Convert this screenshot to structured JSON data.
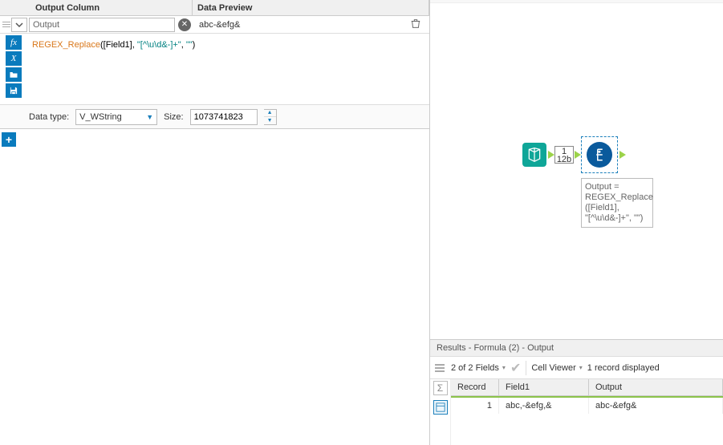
{
  "headers": {
    "output_col": "Output Column",
    "data_preview": "Data Preview"
  },
  "field": {
    "name": "Output",
    "preview": "abc-&efg&",
    "formula_fn": "REGEX_Replace",
    "formula_args_plain": "([Field1], ",
    "formula_pat": "\"[^\\u\\d&-]+\"",
    "formula_mid": ", ",
    "formula_rep": "\"\"",
    "formula_close": ")",
    "datatype_label": "Data type:",
    "datatype_value": "V_WString",
    "size_label": "Size:",
    "size_value": "1073741823"
  },
  "canvas": {
    "badge_top": "1",
    "badge_bottom": "12b",
    "tooltip_l1": "Output =",
    "tooltip_l2": "REGEX_Replace",
    "tooltip_l3": "([Field1],",
    "tooltip_l4": "\"[^\\u\\d&-]+\", \"\")"
  },
  "results": {
    "title": "Results - Formula (2) - Output",
    "fields_text": "2 of 2 Fields",
    "cell_viewer": "Cell Viewer",
    "records_text": "1 record displayed",
    "cols": {
      "record": "Record",
      "field1": "Field1",
      "output": "Output"
    },
    "row": {
      "record": "1",
      "field1": "abc,-&efg,&",
      "output": "abc-&efg&"
    }
  }
}
